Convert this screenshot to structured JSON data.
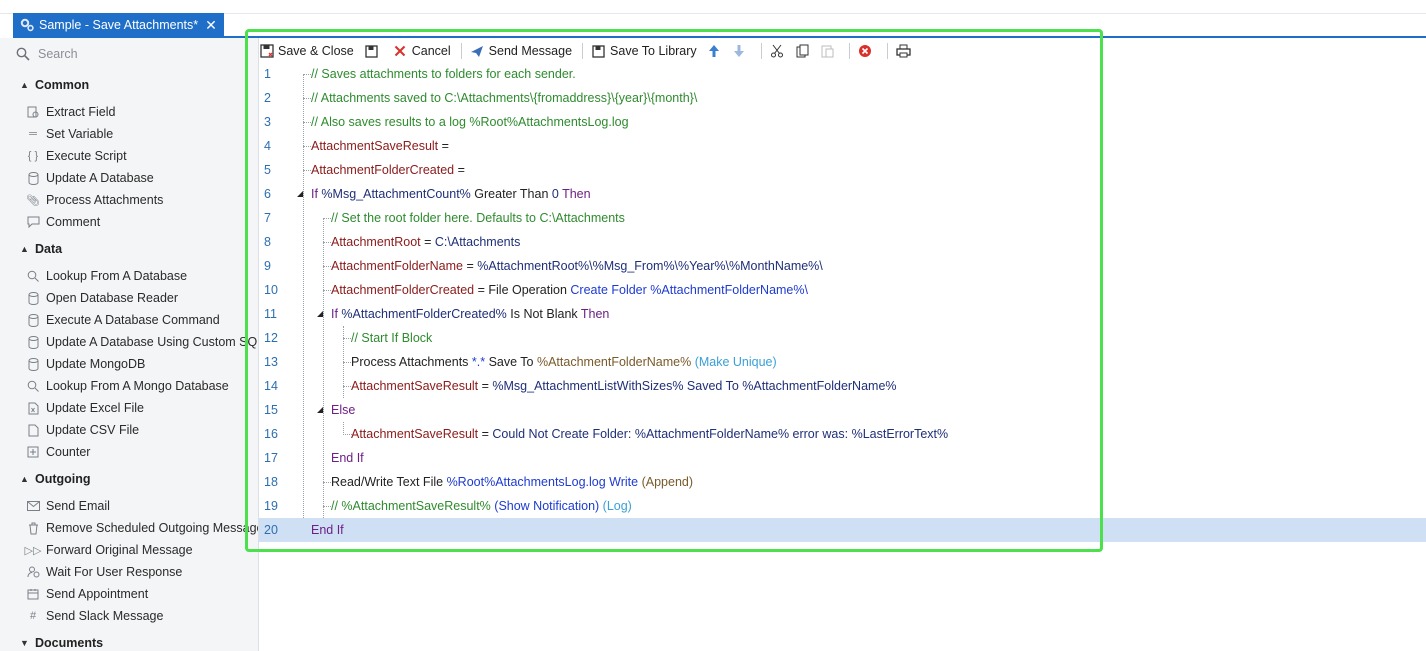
{
  "tab": {
    "title": "Sample - Save Attachments*",
    "close": "✕"
  },
  "sidebar": {
    "search_placeholder": "Search",
    "sections": [
      {
        "label": "Common",
        "items": [
          "Extract Field",
          "Set Variable",
          "Execute Script",
          "Update A Database",
          "Process Attachments",
          "Comment"
        ]
      },
      {
        "label": "Data",
        "items": [
          "Lookup From A Database",
          "Open Database Reader",
          "Execute A Database Command",
          "Update A Database Using Custom SQL",
          "Update MongoDB",
          "Lookup From A Mongo Database",
          "Update Excel File",
          "Update CSV File",
          "Counter"
        ]
      },
      {
        "label": "Outgoing",
        "items": [
          "Send Email",
          "Remove Scheduled Outgoing Message",
          "Forward Original Message",
          "Wait For User Response",
          "Send Appointment",
          "Send Slack Message"
        ]
      },
      {
        "label": "Documents",
        "items": []
      }
    ]
  },
  "toolbar": {
    "save_close": "Save & Close",
    "cancel": "Cancel",
    "send_message": "Send Message",
    "save_library": "Save To Library"
  },
  "code": {
    "line_numbers": [
      "1",
      "2",
      "3",
      "4",
      "5",
      "6",
      "7",
      "8",
      "9",
      "10",
      "11",
      "12",
      "13",
      "14",
      "15",
      "16",
      "17",
      "18",
      "19",
      "20"
    ],
    "l1": "// Saves attachments to folders for each sender.",
    "l2": "// Attachments saved to C:\\Attachments\\{fromaddress}\\{year}\\{month}\\",
    "l3": "// Also saves results to a log %Root%AttachmentsLog.log",
    "l4_var": "AttachmentSaveResult",
    "l4_eq": " =",
    "l5_var": "AttachmentFolderCreated",
    "l5_eq": " =",
    "l6_if": "If ",
    "l6_var": "%Msg_AttachmentCount%",
    "l6_op": " Greater Than ",
    "l6_val": "0",
    "l6_then": " Then",
    "l7": "// Set the root folder here. Defaults to C:\\Attachments",
    "l8_var": "AttachmentRoot",
    "l8_eq": " = ",
    "l8_val": "C:\\Attachments",
    "l9_var": "AttachmentFolderName",
    "l9_eq": " = ",
    "l9_val": "%AttachmentRoot%\\%Msg_From%\\%Year%\\%MonthName%\\",
    "l10_var": "AttachmentFolderCreated",
    "l10_eq": " = ",
    "l10_fn": "File Operation ",
    "l10_val": "Create Folder %AttachmentFolderName%\\",
    "l11_if": "If ",
    "l11_var": "%AttachmentFolderCreated%",
    "l11_op": " Is Not Blank ",
    "l11_then": "Then",
    "l12": "// Start If Block",
    "l13_fn": "Process Attachments ",
    "l13_pat": "*.*",
    "l13_to": " Save To ",
    "l13_var": "%AttachmentFolderName%",
    "l13_opt": " (Make Unique)",
    "l14_var": "AttachmentSaveResult",
    "l14_eq": " = ",
    "l14_val": "%Msg_AttachmentListWithSizes% Saved To %AttachmentFolderName%",
    "l15": "Else",
    "l16_var": "AttachmentSaveResult",
    "l16_eq": " = ",
    "l16_val": "Could Not Create Folder: %AttachmentFolderName% error was: %LastErrorText%",
    "l17": "End If",
    "l18_fn": "Read/Write Text File ",
    "l18_file": "%Root%AttachmentsLog.log",
    "l18_mode": " Write",
    "l18_opt": " (Append)",
    "l19_cm": "// %AttachmentSaveResult% ",
    "l19_opt1": "(Show Notification)",
    "l19_opt2": " (Log)",
    "l20": "End If"
  }
}
